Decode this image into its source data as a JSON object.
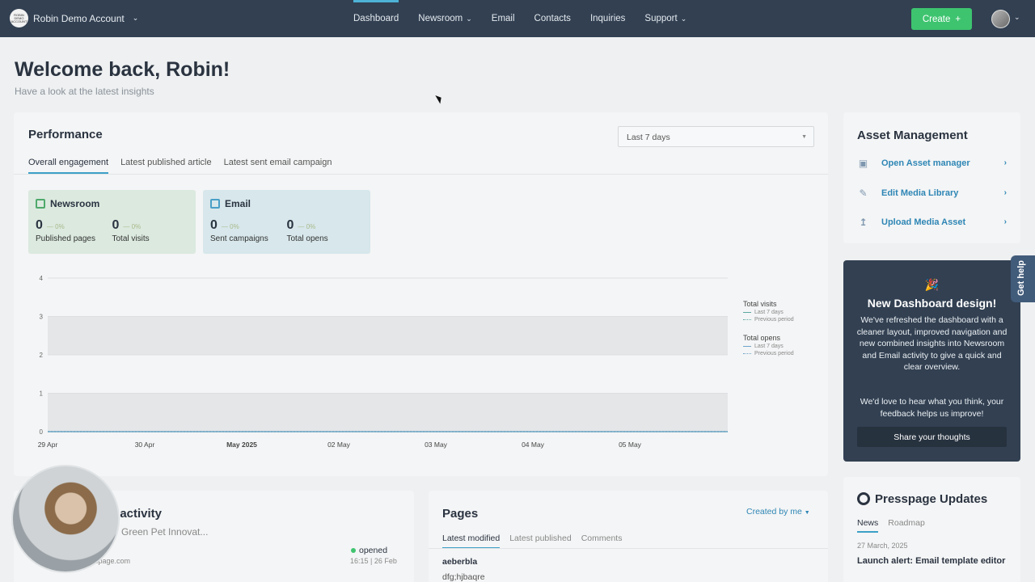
{
  "topbar": {
    "account_logo_text": "ROBIN DEMO ACCOUNT",
    "account_name": "Robin Demo Account",
    "nav": [
      {
        "label": "Dashboard",
        "active": true,
        "dropdown": false
      },
      {
        "label": "Newsroom",
        "active": false,
        "dropdown": true
      },
      {
        "label": "Email",
        "active": false,
        "dropdown": false
      },
      {
        "label": "Contacts",
        "active": false,
        "dropdown": false
      },
      {
        "label": "Inquiries",
        "active": false,
        "dropdown": false
      },
      {
        "label": "Support",
        "active": false,
        "dropdown": true
      }
    ],
    "create_label": "Create",
    "create_icon": "plus-icon"
  },
  "header": {
    "title": "Welcome back, Robin!",
    "subtitle": "Have a look at the latest insights"
  },
  "performance": {
    "title": "Performance",
    "range": "Last 7 days",
    "tabs": [
      "Overall engagement",
      "Latest published article",
      "Latest sent email campaign"
    ],
    "newsroom": {
      "title": "Newsroom",
      "stats": [
        {
          "value": "0",
          "pct": "— 0%",
          "label": "Published pages"
        },
        {
          "value": "0",
          "pct": "— 0%",
          "label": "Total visits"
        }
      ]
    },
    "email": {
      "title": "Email",
      "stats": [
        {
          "value": "0",
          "pct": "— 0%",
          "label": "Sent campaigns"
        },
        {
          "value": "0",
          "pct": "— 0%",
          "label": "Total opens"
        }
      ]
    },
    "legend": {
      "visits_title": "Total visits",
      "opens_title": "Total opens",
      "last": "Last 7 days",
      "prev": "Previous period"
    }
  },
  "chart_data": {
    "type": "line",
    "categories": [
      "29 Apr",
      "30 Apr",
      "May 2025",
      "02 May",
      "03 May",
      "04 May",
      "05 May"
    ],
    "yticks": [
      0,
      1,
      2,
      3,
      4
    ],
    "ylim": [
      0,
      4
    ],
    "series": [
      {
        "name": "Total visits — Last 7 days",
        "values": [
          0,
          0,
          0,
          0,
          0,
          0,
          0
        ]
      },
      {
        "name": "Total visits — Previous period",
        "values": [
          0,
          0,
          0,
          0,
          0,
          0,
          0
        ]
      },
      {
        "name": "Total opens — Last 7 days",
        "values": [
          0,
          0,
          0,
          0,
          0,
          0,
          0
        ]
      },
      {
        "name": "Total opens — Previous period",
        "values": [
          0,
          0,
          0,
          0,
          0,
          0,
          0
        ]
      }
    ]
  },
  "asset_management": {
    "title": "Asset Management",
    "links": [
      {
        "label": "Open Asset manager",
        "icon": "image-gallery-icon"
      },
      {
        "label": "Edit Media Library",
        "icon": "pencil-icon"
      },
      {
        "label": "Upload Media Asset",
        "icon": "upload-icon"
      }
    ]
  },
  "promo": {
    "icon": "party-popper-icon",
    "title": "New Dashboard design!",
    "body": "We've refreshed the dashboard with a cleaner layout, improved navigation and new combined insights into Newsroom and Email activity to give a quick and clear overview.",
    "body2": "We'd love to hear what you think, your feedback helps us improve!",
    "button": "Share your thoughts"
  },
  "get_help": "Get help",
  "activity": {
    "title_partial": "n activity",
    "subtitle_partial": "Green Pet Innovat...",
    "email_partial": "spage.com",
    "status": "opened",
    "time": "16:15 | 26 Feb"
  },
  "pages": {
    "title": "Pages",
    "filter": "Created by me",
    "tabs": [
      "Latest modified",
      "Latest published",
      "Comments"
    ],
    "items": [
      "aeberbla",
      "dfg;hjbaqre"
    ]
  },
  "updates": {
    "title": "Presspage Updates",
    "tabs": [
      "News",
      "Roadmap"
    ],
    "date": "27 March, 2025",
    "headline": "Launch alert: Email template editor"
  },
  "colors": {
    "topbar": "#324052",
    "accent": "#3ca0c7",
    "create": "#3ec46f",
    "link": "#2e86b5"
  }
}
